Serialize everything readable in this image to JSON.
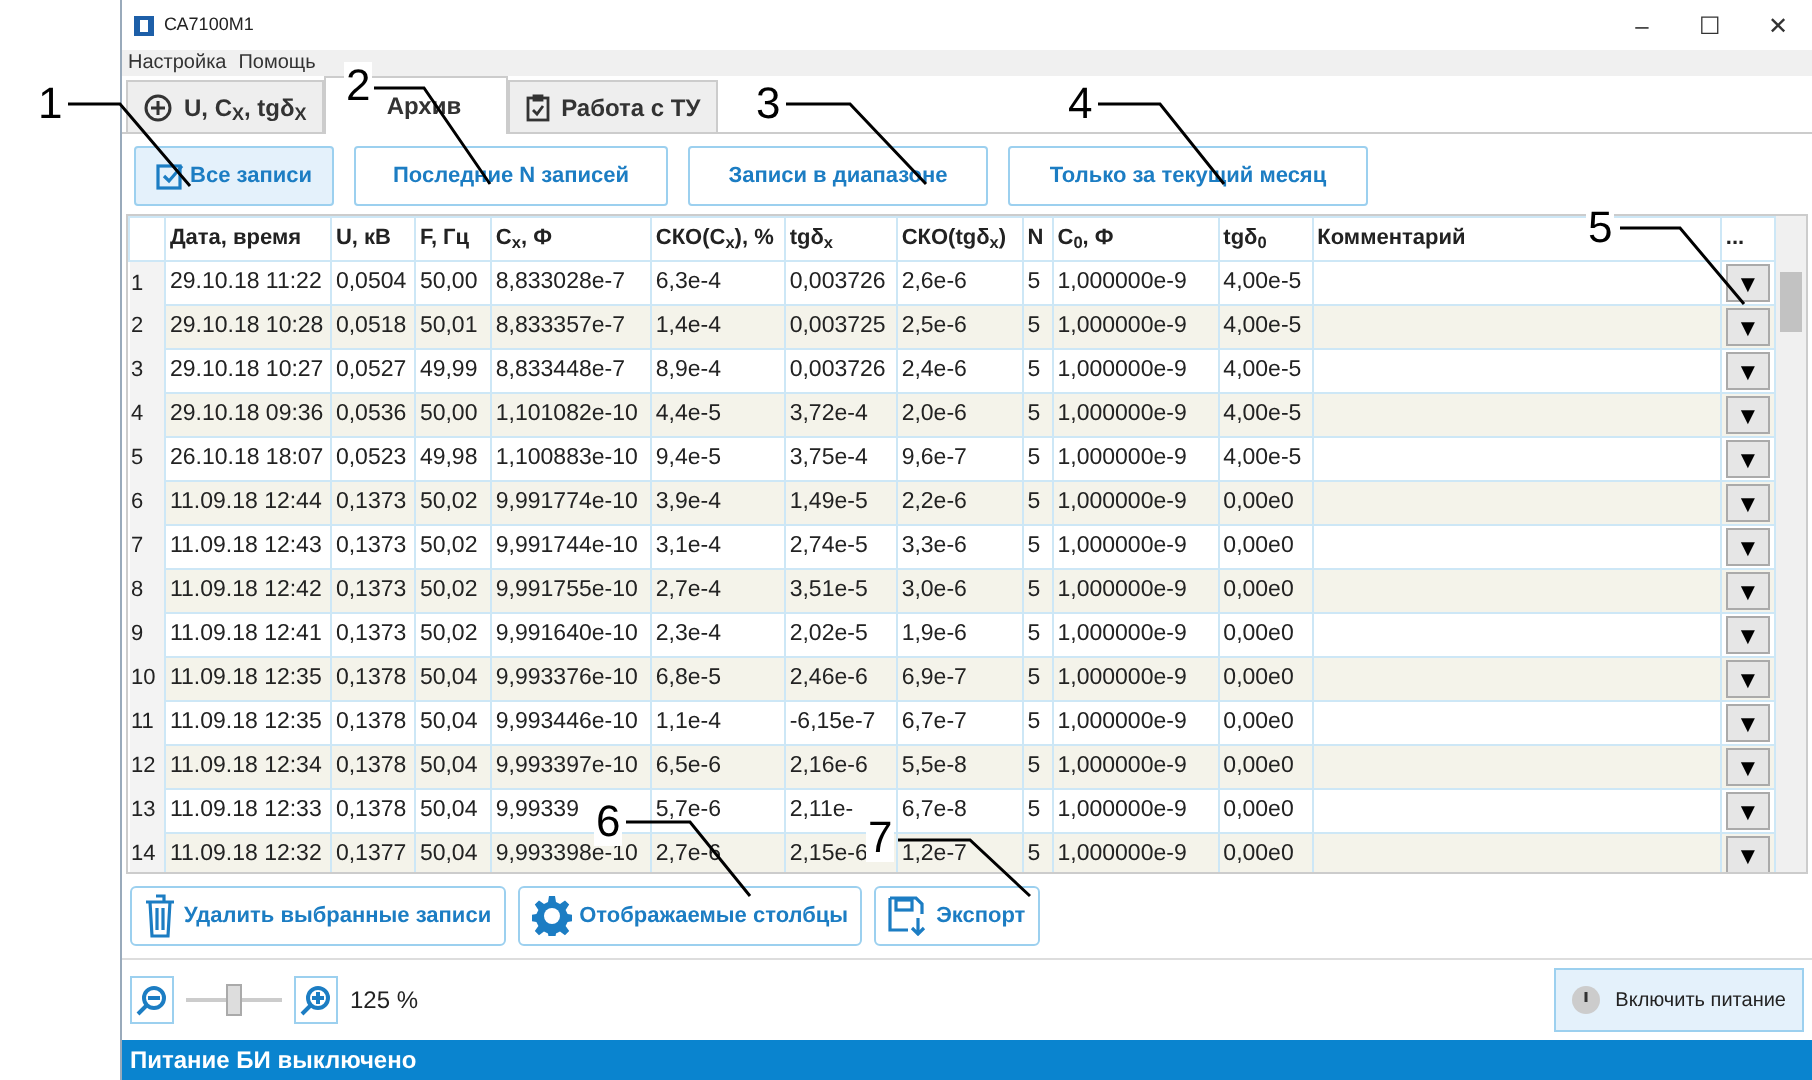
{
  "window": {
    "title": "СА7100М1",
    "controls": [
      "–",
      "☐",
      "✕"
    ]
  },
  "menu": [
    "Настройка",
    "Помощь"
  ],
  "tabs": [
    {
      "label": "U, C$_{X}$, tgδ$_{X}$",
      "selected": false
    },
    {
      "label": "Архив",
      "selected": true
    },
    {
      "label": "Работа с ТУ",
      "selected": false
    }
  ],
  "filters": [
    {
      "label": "Все записи",
      "selected": true
    },
    {
      "label": "Последние N записей",
      "selected": false
    },
    {
      "label": "Записи в диапазоне",
      "selected": false
    },
    {
      "label": "Только за текущий месяц",
      "selected": false
    }
  ],
  "table": {
    "columns": [
      "Дата, время",
      "U, кВ",
      "F, Гц",
      "C$_{x}$, Ф",
      "СКО(C$_{x}$), %",
      "tgδ$_{x}$",
      "СКО(tgδ$_{x}$)",
      "N",
      "C$_{0}$, Ф",
      "tgδ$_{0}$",
      "Комментарий",
      "..."
    ],
    "rows": [
      {
        "num": "1",
        "cells": [
          "29.10.18 11:22",
          "0,0504",
          "50,00",
          "8,833028e-7",
          "6,3e-4",
          "0,003726",
          "2,6e-6",
          "5",
          "1,000000e-9",
          "4,00e-5",
          ""
        ],
        "action": "▼"
      },
      {
        "num": "2",
        "cells": [
          "29.10.18 10:28",
          "0,0518",
          "50,01",
          "8,833357e-7",
          "1,4e-4",
          "0,003725",
          "2,5e-6",
          "5",
          "1,000000e-9",
          "4,00e-5",
          ""
        ],
        "action": "▼"
      },
      {
        "num": "3",
        "cells": [
          "29.10.18 10:27",
          "0,0527",
          "49,99",
          "8,833448e-7",
          "8,9e-4",
          "0,003726",
          "2,4e-6",
          "5",
          "1,000000e-9",
          "4,00e-5",
          ""
        ],
        "action": "▼"
      },
      {
        "num": "4",
        "cells": [
          "29.10.18 09:36",
          "0,0536",
          "50,00",
          "1,101082e-10",
          "4,4e-5",
          "3,72e-4",
          "2,0e-6",
          "5",
          "1,000000e-9",
          "4,00e-5",
          ""
        ],
        "action": "▼"
      },
      {
        "num": "5",
        "cells": [
          "26.10.18 18:07",
          "0,0523",
          "49,98",
          "1,100883e-10",
          "9,4e-5",
          "3,75e-4",
          "9,6e-7",
          "5",
          "1,000000e-9",
          "4,00e-5",
          ""
        ],
        "action": "▼"
      },
      {
        "num": "6",
        "cells": [
          "11.09.18 12:44",
          "0,1373",
          "50,02",
          "9,991774e-10",
          "3,9e-4",
          "1,49e-5",
          "2,2e-6",
          "5",
          "1,000000e-9",
          "0,00e0",
          ""
        ],
        "action": "▼"
      },
      {
        "num": "7",
        "cells": [
          "11.09.18 12:43",
          "0,1373",
          "50,02",
          "9,991744e-10",
          "3,1e-4",
          "2,74e-5",
          "3,3e-6",
          "5",
          "1,000000e-9",
          "0,00e0",
          ""
        ],
        "action": "▼"
      },
      {
        "num": "8",
        "cells": [
          "11.09.18 12:42",
          "0,1373",
          "50,02",
          "9,991755e-10",
          "2,7e-4",
          "3,51e-5",
          "3,0e-6",
          "5",
          "1,000000e-9",
          "0,00e0",
          ""
        ],
        "action": "▼"
      },
      {
        "num": "9",
        "cells": [
          "11.09.18 12:41",
          "0,1373",
          "50,02",
          "9,991640e-10",
          "2,3e-4",
          "2,02e-5",
          "1,9e-6",
          "5",
          "1,000000e-9",
          "0,00e0",
          ""
        ],
        "action": "▼"
      },
      {
        "num": "10",
        "cells": [
          "11.09.18 12:35",
          "0,1378",
          "50,04",
          "9,993376e-10",
          "6,8e-5",
          "2,46e-6",
          "6,9e-7",
          "5",
          "1,000000e-9",
          "0,00e0",
          ""
        ],
        "action": "▼"
      },
      {
        "num": "11",
        "cells": [
          "11.09.18 12:35",
          "0,1378",
          "50,04",
          "9,993446e-10",
          "1,1e-4",
          "-6,15e-7",
          "6,7e-7",
          "5",
          "1,000000e-9",
          "0,00e0",
          ""
        ],
        "action": "▼"
      },
      {
        "num": "12",
        "cells": [
          "11.09.18 12:34",
          "0,1378",
          "50,04",
          "9,993397e-10",
          "6,5e-6",
          "2,16e-6",
          "5,5e-8",
          "5",
          "1,000000e-9",
          "0,00e0",
          ""
        ],
        "action": "▼"
      },
      {
        "num": "13",
        "cells": [
          "11.09.18 12:33",
          "0,1378",
          "50,04",
          "9,99339",
          "5,7e-6",
          "2,11e-",
          "6,7e-8",
          "5",
          "1,000000e-9",
          "0,00e0",
          ""
        ],
        "action": "▼"
      },
      {
        "num": "14",
        "cells": [
          "11.09.18 12:32",
          "0,1377",
          "50,04",
          "9,993398e-10",
          "2,7e-6",
          "2,15e-6",
          "1,2e-7",
          "5",
          "1,000000e-9",
          "0,00e0",
          ""
        ],
        "action": "▼"
      }
    ]
  },
  "actions": [
    {
      "label": "Удалить выбранные записи"
    },
    {
      "label": "Отображаемые столбцы"
    },
    {
      "label": "Экспорт"
    }
  ],
  "zoom": {
    "level": 0.5,
    "reading": "125 %"
  },
  "power_button": "Включить питание",
  "status_bar": "Питание БИ выключено",
  "callouts": [
    "1",
    "2",
    "3",
    "4",
    "5",
    "6",
    "7"
  ]
}
